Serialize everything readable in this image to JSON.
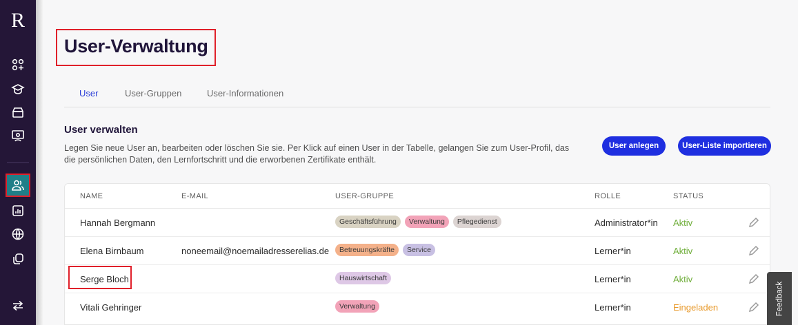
{
  "sidebar": {
    "logo": "R",
    "icons": [
      "dashboard-icon",
      "graduation-cap-icon",
      "archive-icon",
      "presentation-icon",
      "users-icon",
      "chart-icon",
      "globe-icon",
      "copy-icon",
      "switch-icon"
    ],
    "active_color": "#1f7f88"
  },
  "page": {
    "title": "User-Verwaltung"
  },
  "tabs": [
    {
      "label": "User",
      "active": true
    },
    {
      "label": "User-Gruppen",
      "active": false
    },
    {
      "label": "User-Informationen",
      "active": false
    }
  ],
  "section": {
    "title": "User verwalten",
    "description": "Legen Sie neue User an, bearbeiten oder löschen Sie sie. Per Klick auf einen User in der Tabelle, gelangen Sie zum User-Profil, das die persönlichen Daten, den Lernfortschritt und die erworbenen Zertifikate enthält."
  },
  "buttons": {
    "create": "User anlegen",
    "import": "User-Liste importieren"
  },
  "table": {
    "headers": {
      "name": "NAME",
      "email": "E-MAIL",
      "group": "USER-GRUPPE",
      "role": "ROLLE",
      "status": "STATUS"
    },
    "rows": [
      {
        "name": "Hannah Bergmann",
        "email": "",
        "tags": [
          {
            "label": "Geschäftsführung",
            "color": "#d9d3c3"
          },
          {
            "label": "Verwaltung",
            "color": "#f2a3b8"
          },
          {
            "label": "Pflegedienst",
            "color": "#dcd4d2"
          }
        ],
        "role": "Administrator*in",
        "status": "Aktiv",
        "status_color": "#6fae3a"
      },
      {
        "name": "Elena Birnbaum",
        "email": "noneemail@noemailadresserelias.de",
        "tags": [
          {
            "label": "Betreuungskräfte",
            "color": "#f4b18a"
          },
          {
            "label": "Service",
            "color": "#c8c0e3"
          }
        ],
        "role": "Lerner*in",
        "status": "Aktiv",
        "status_color": "#6fae3a"
      },
      {
        "name": "Serge Bloch",
        "email": "",
        "tags": [
          {
            "label": "Hauswirtschaft",
            "color": "#dec8e6"
          }
        ],
        "role": "Lerner*in",
        "status": "Aktiv",
        "status_color": "#6fae3a"
      },
      {
        "name": "Vitali Gehringer",
        "email": "",
        "tags": [
          {
            "label": "Verwaltung",
            "color": "#f2a3b8"
          }
        ],
        "role": "Lerner*in",
        "status": "Eingeladen",
        "status_color": "#e89a2c"
      }
    ]
  },
  "feedback": {
    "label": "Feedback"
  }
}
